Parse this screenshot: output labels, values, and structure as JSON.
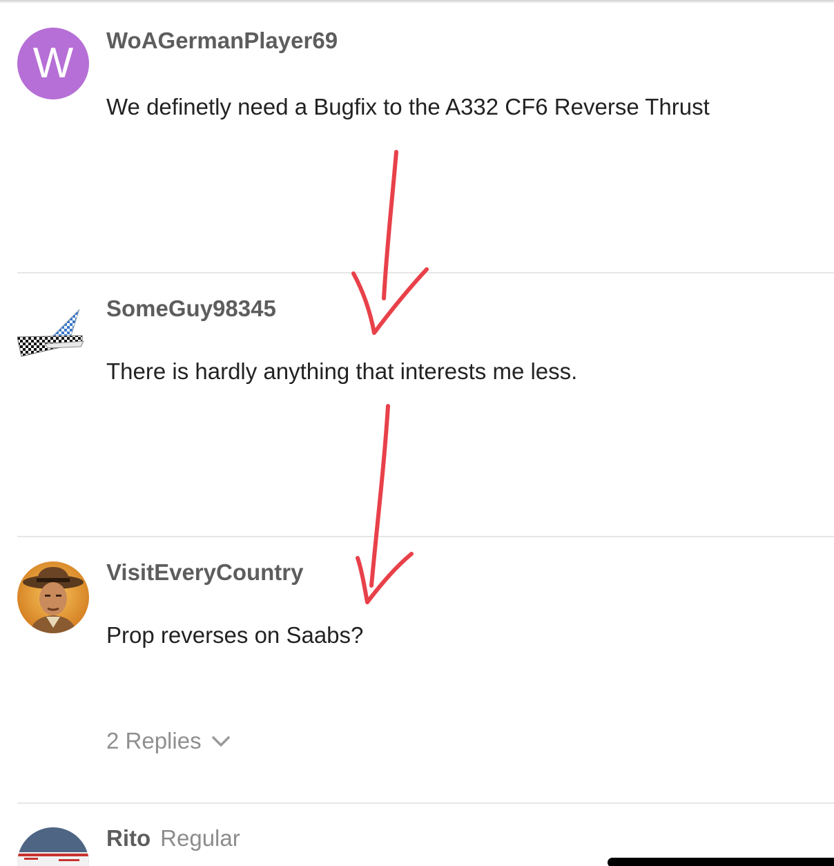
{
  "posts": [
    {
      "avatar_letter": "W",
      "username": "WoAGermanPlayer69",
      "message": "We definetly need a Bugfix to the A332 CF6 Reverse Thrust"
    },
    {
      "avatar_icon": "airplane-tail-icon",
      "username": "SomeGuy98345",
      "message": "There is hardly anything that interests me less."
    },
    {
      "avatar_icon": "adventurer-portrait-icon",
      "username": "VisitEveryCountry",
      "message": "Prop reverses on Saabs?",
      "replies_label": "2 Replies"
    },
    {
      "avatar_icon": "landscape-avatar-icon",
      "username": "Rito",
      "user_title": "Regular"
    }
  ],
  "colors": {
    "annotation_arrow": "#e8414a",
    "avatar_w": "#b66fd6"
  }
}
